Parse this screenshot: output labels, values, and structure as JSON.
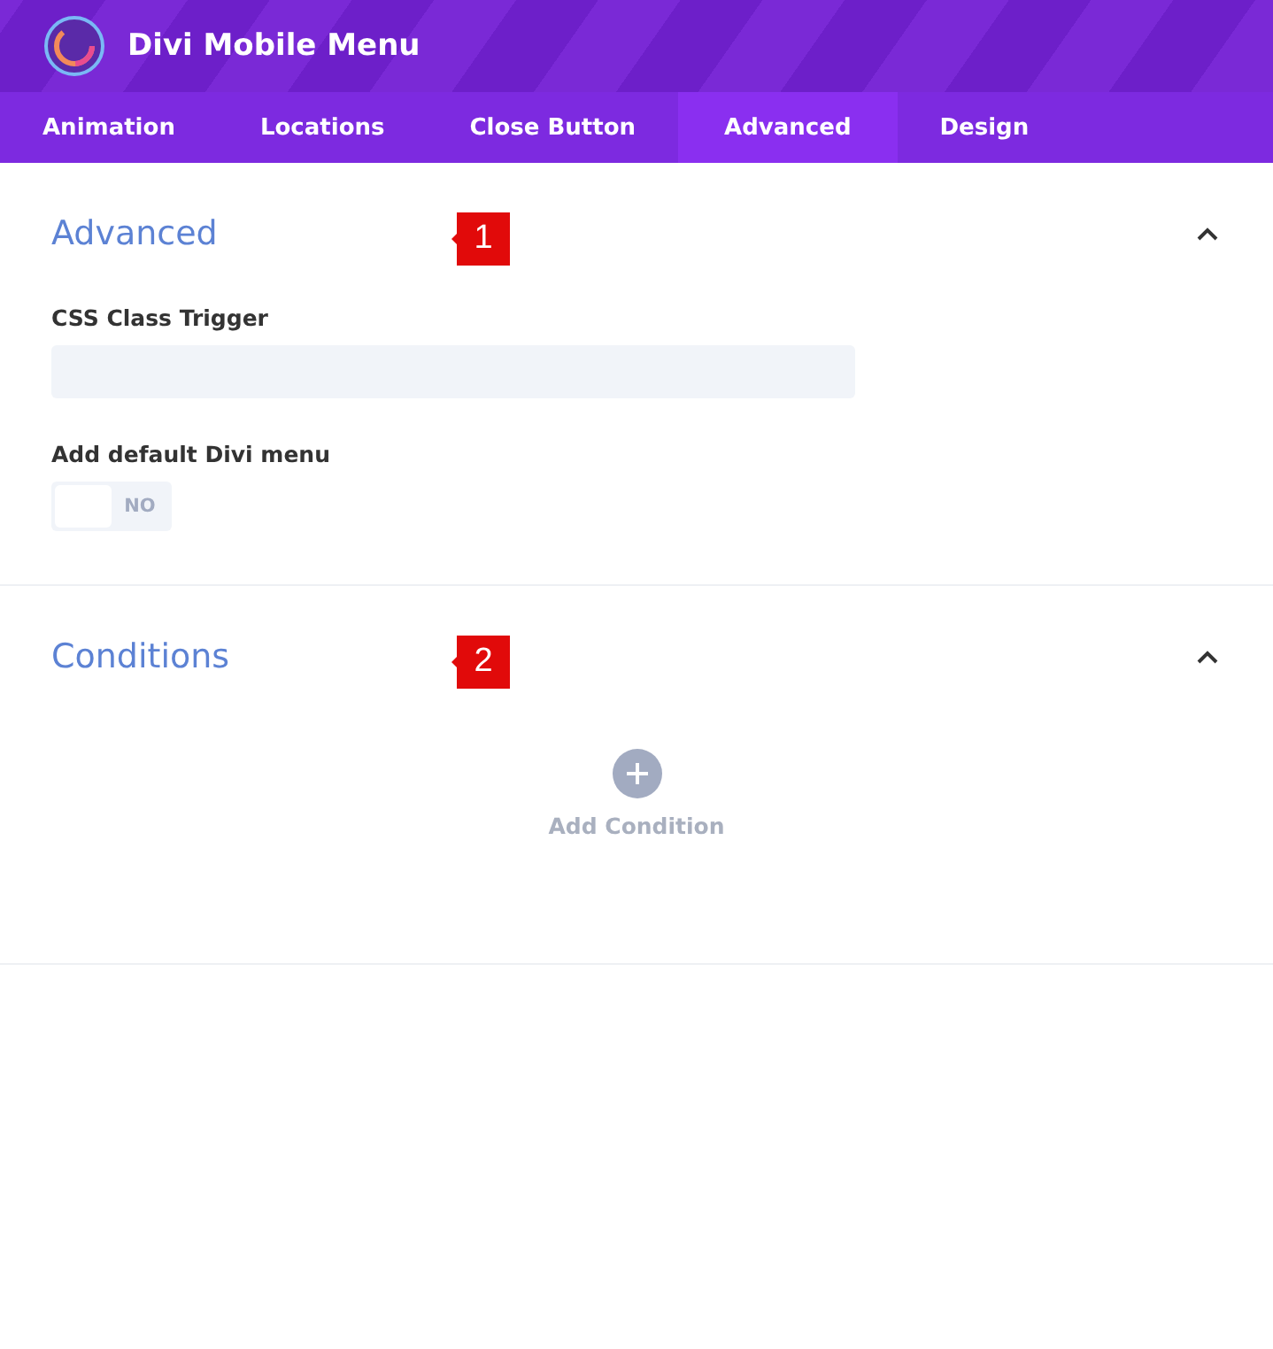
{
  "window": {
    "title": "Divi Mobile Menu"
  },
  "tabs": [
    {
      "label": "Animation",
      "selected": false
    },
    {
      "label": "Locations",
      "selected": false
    },
    {
      "label": "Close Button",
      "selected": false
    },
    {
      "label": "Advanced",
      "selected": true
    },
    {
      "label": "Design",
      "selected": false
    }
  ],
  "sections": [
    {
      "title": "Advanced",
      "expanded": true,
      "marker": "1",
      "fields": [
        {
          "kind": "text",
          "label": "CSS Class Trigger"
        },
        {
          "kind": "toggle",
          "label": "Add default Divi menu",
          "on": false,
          "value": "NO"
        }
      ]
    },
    {
      "title": "Conditions",
      "expanded": true,
      "marker": "2",
      "add_label": "Add Condition"
    }
  ]
}
